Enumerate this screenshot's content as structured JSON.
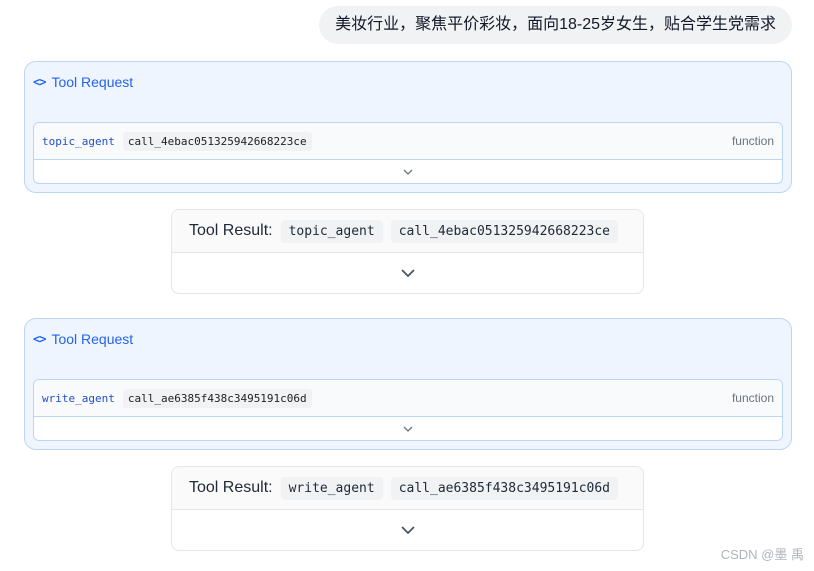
{
  "user_message": "美妆行业，聚焦平价彩妆，面向18-25岁女生，贴合学生党需求",
  "tool_requests": [
    {
      "icon": "code-icon",
      "header": "Tool Request",
      "function_name": "topic_agent",
      "call_id": "call_4ebac051325942668223ce",
      "kind": "function"
    },
    {
      "icon": "code-icon",
      "header": "Tool Request",
      "function_name": "write_agent",
      "call_id": "call_ae6385f438c3495191c06d",
      "kind": "function"
    }
  ],
  "tool_results": [
    {
      "title": "Tool Result:",
      "function_name": "topic_agent",
      "call_id": "call_4ebac051325942668223ce"
    },
    {
      "title": "Tool Result:",
      "function_name": "write_agent",
      "call_id": "call_ae6385f438c3495191c06d"
    }
  ],
  "watermark": "CSDN @墨 禹"
}
